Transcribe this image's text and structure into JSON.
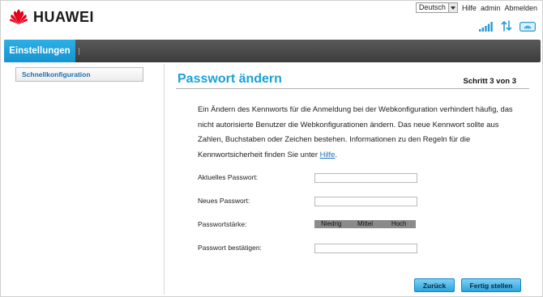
{
  "brand": {
    "name": "HUAWEI",
    "color": "#e3001b"
  },
  "top_links": {
    "language": "Deutsch",
    "help": "Hilfe",
    "user": "admin",
    "logout": "Abmelden"
  },
  "status_icons": [
    "signal-strength-icon",
    "data-transfer-icon",
    "wlan-icon"
  ],
  "nav": {
    "active_tab": "Einstellungen",
    "accent": "#1ea3dd"
  },
  "sidebar": {
    "items": [
      {
        "label": "Schnellkonfiguration"
      }
    ]
  },
  "main": {
    "title": "Passwort ändern",
    "step": "Schritt 3 von 3",
    "description": "Ein Ändern des Kennworts für die Anmeldung bei der Webkonfiguration verhindert häufig, das nicht autorisierte Benutzer die Webkonfigurationen ändern. Das neue Kennwort sollte aus Zahlen, Buchstaben oder Zeichen bestehen. Informationen zu den Regeln für die Kennwortsicherheit finden Sie unter ",
    "help_link": "Hilfe",
    "description_end": "."
  },
  "form": {
    "current_password_label": "Aktuelles Passwort:",
    "new_password_label": "Neues Passwort:",
    "strength_label": "Passwortstärke:",
    "strength_levels": [
      "Niedrig",
      "Mittel",
      "Hoch"
    ],
    "confirm_password_label": "Passwort bestätigen:",
    "current_password_value": "",
    "new_password_value": "",
    "confirm_password_value": ""
  },
  "buttons": {
    "back": "Zurück",
    "finish": "Fertig stellen"
  }
}
